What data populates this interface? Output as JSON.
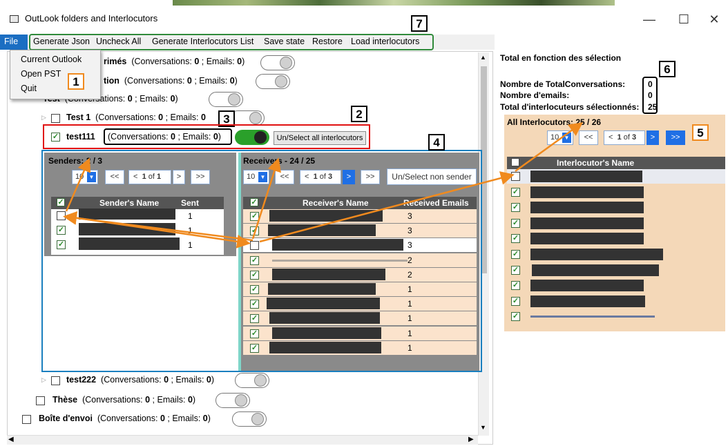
{
  "window": {
    "title": "OutLook folders and Interlocutors",
    "controls": {
      "minimize": "—",
      "maximize": "☐",
      "close": "✕"
    }
  },
  "menu": {
    "file": "File",
    "items": [
      "Generate Json",
      "Uncheck All",
      "Generate Interlocutors List",
      "Save state",
      "Restore",
      "Load interlocutors"
    ],
    "dropdown": [
      "Current Outlook",
      "Open PST",
      "Quit"
    ]
  },
  "annotations": [
    "1",
    "2",
    "3",
    "4",
    "5",
    "6",
    "7"
  ],
  "tree": {
    "rows": [
      {
        "label": "rimés",
        "conv_prefix": "(Conversations: ",
        "conv": "0",
        "sep": " ;  Emails: ",
        "emails": "0",
        "close": ")"
      },
      {
        "label": "tion",
        "conv_prefix": "(Conversations: ",
        "conv": "0",
        "sep": " ;  Emails: ",
        "emails": "0",
        "close": ")"
      },
      {
        "label": "Test",
        "conv_prefix": "(Conversations: ",
        "conv": "0",
        "sep": " ;  Emails: ",
        "emails": "0",
        "close": ")"
      },
      {
        "label": "Test 1",
        "conv_prefix": "(Conversations: ",
        "conv": "0",
        "sep": " ;  Emails: ",
        "emails": "0",
        "close": ""
      },
      {
        "label": "test111",
        "conv_prefix": "(Conversations: ",
        "conv": "0",
        "sep": " ;  Emails: ",
        "emails": "0",
        "close": ")"
      },
      {
        "label": "test222",
        "conv_prefix": "(Conversations: ",
        "conv": "0",
        "sep": " ;  Emails: ",
        "emails": "0",
        "close": ")"
      },
      {
        "label": "Thèse",
        "conv_prefix": "(Conversations: ",
        "conv": "0",
        "sep": " ;  Emails: ",
        "emails": "0",
        "close": ")"
      },
      {
        "label": "Boîte d'envoi",
        "conv_prefix": "(Conversations: ",
        "conv": "0",
        "sep": " ;  Emails: ",
        "emails": "0",
        "close": ")"
      }
    ],
    "select_all_button": "Un/Select all interlocutors"
  },
  "senders": {
    "title_prefix": "Senders: ",
    "count": "2 / 3",
    "page_size": "10",
    "first": "<<",
    "prev": "<",
    "page_current": "1",
    "page_of": " of ",
    "page_total": "1",
    "next": ">",
    "last": ">>",
    "columns": [
      "Sender's Name",
      "Sent Emails"
    ],
    "rows": [
      {
        "checked": false,
        "sent": "1"
      },
      {
        "checked": true,
        "sent": "1"
      },
      {
        "checked": true,
        "sent": "1"
      }
    ]
  },
  "receivers": {
    "title_prefix": "Receivers - ",
    "count": "24 / 25",
    "page_size": "10",
    "first": "<<",
    "prev": "<",
    "page_current": "1",
    "page_of": " of ",
    "page_total": "3",
    "next": ">",
    "last": ">>",
    "non_sender_button": "Un/Select non sender",
    "columns": [
      "Receiver's Name",
      "Received Emails"
    ],
    "rows": [
      {
        "checked": true,
        "received": "3"
      },
      {
        "checked": true,
        "received": "3"
      },
      {
        "checked": false,
        "received": "3"
      },
      {
        "checked": true,
        "received": "2"
      },
      {
        "checked": true,
        "received": "2"
      },
      {
        "checked": true,
        "received": "1"
      },
      {
        "checked": true,
        "received": "1"
      },
      {
        "checked": true,
        "received": "1"
      },
      {
        "checked": true,
        "received": "1"
      },
      {
        "checked": true,
        "received": "1"
      }
    ]
  },
  "summary": {
    "title": "Total en fonction des sélection",
    "total_conversations_label": "Nombre de TotalConversations:",
    "total_conversations": "0",
    "emails_label": "Nombre d'emails:",
    "emails": "0",
    "interlocutors_label": "Total d'interlocuteurs sélectionnés:",
    "interlocutors": "25"
  },
  "all_interlocutors": {
    "title_prefix": "All Interlocutors: ",
    "count": "25 / 26",
    "page_size": "10",
    "first": "<<",
    "prev": "<",
    "page_current": "1",
    "page_of": " of ",
    "page_total": "3",
    "next": ">",
    "last": ">>",
    "column": "Interlocutor's Name",
    "rows": [
      false,
      true,
      true,
      true,
      true,
      true,
      true,
      true,
      true,
      true
    ]
  },
  "colors": {
    "accent": "#1b6ec2",
    "red_box": "#e01010",
    "blue_box": "#1a7fbf",
    "green_box": "#2f8a3a",
    "arrow": "#f08a1e",
    "row_peach": "#fbe3cc",
    "panel_peach": "#f4d8b8"
  },
  "icons": [
    "app-icon",
    "expand-triangle-icon",
    "checkbox-icon",
    "toggle-switch",
    "dropdown-chevron-icon",
    "scroll-up-icon",
    "scroll-down-icon",
    "scroll-left-icon",
    "scroll-right-icon"
  ]
}
